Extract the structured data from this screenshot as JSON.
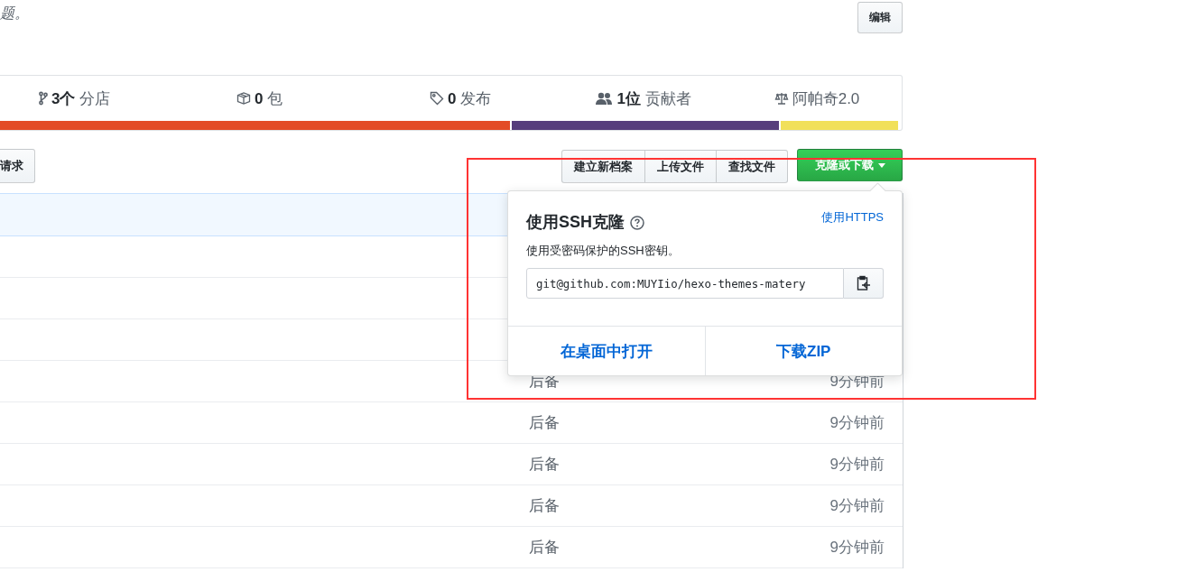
{
  "description_tail": "题。",
  "edit_button": "编辑",
  "stats": [
    {
      "kind": "branches",
      "count": "3个",
      "label": "分店"
    },
    {
      "kind": "packages",
      "count": "0",
      "label": "包"
    },
    {
      "kind": "releases",
      "count": "0",
      "label": "发布"
    },
    {
      "kind": "contributors",
      "count": "1位",
      "label": "贡献者"
    },
    {
      "kind": "license",
      "label": "阿帕奇2.0"
    }
  ],
  "language_bar": [
    {
      "color": "#e34c26"
    },
    {
      "color": "#563d7c"
    },
    {
      "color": "#f1e05a"
    }
  ],
  "pull_request_button": "请求",
  "file_buttons": [
    "建立新档案",
    "上传文件",
    "查找文件"
  ],
  "clone_button": "克隆或下载",
  "clone_popover": {
    "title": "使用SSH克隆",
    "switch_link": "使用HTTPS",
    "description": "使用受密码保护的SSH密钥。",
    "url": "git@github.com:MUYIio/hexo-themes-matery",
    "actions": [
      "在桌面中打开",
      "下载ZIP"
    ]
  },
  "files": [
    {
      "message": "后备",
      "time": "9分钟前"
    },
    {
      "message": "后备",
      "time": "9分钟前"
    },
    {
      "message": "后备",
      "time": "9分钟前"
    },
    {
      "message": "后备",
      "time": "9分钟前"
    },
    {
      "message": "后备",
      "time": "9分钟前"
    }
  ]
}
